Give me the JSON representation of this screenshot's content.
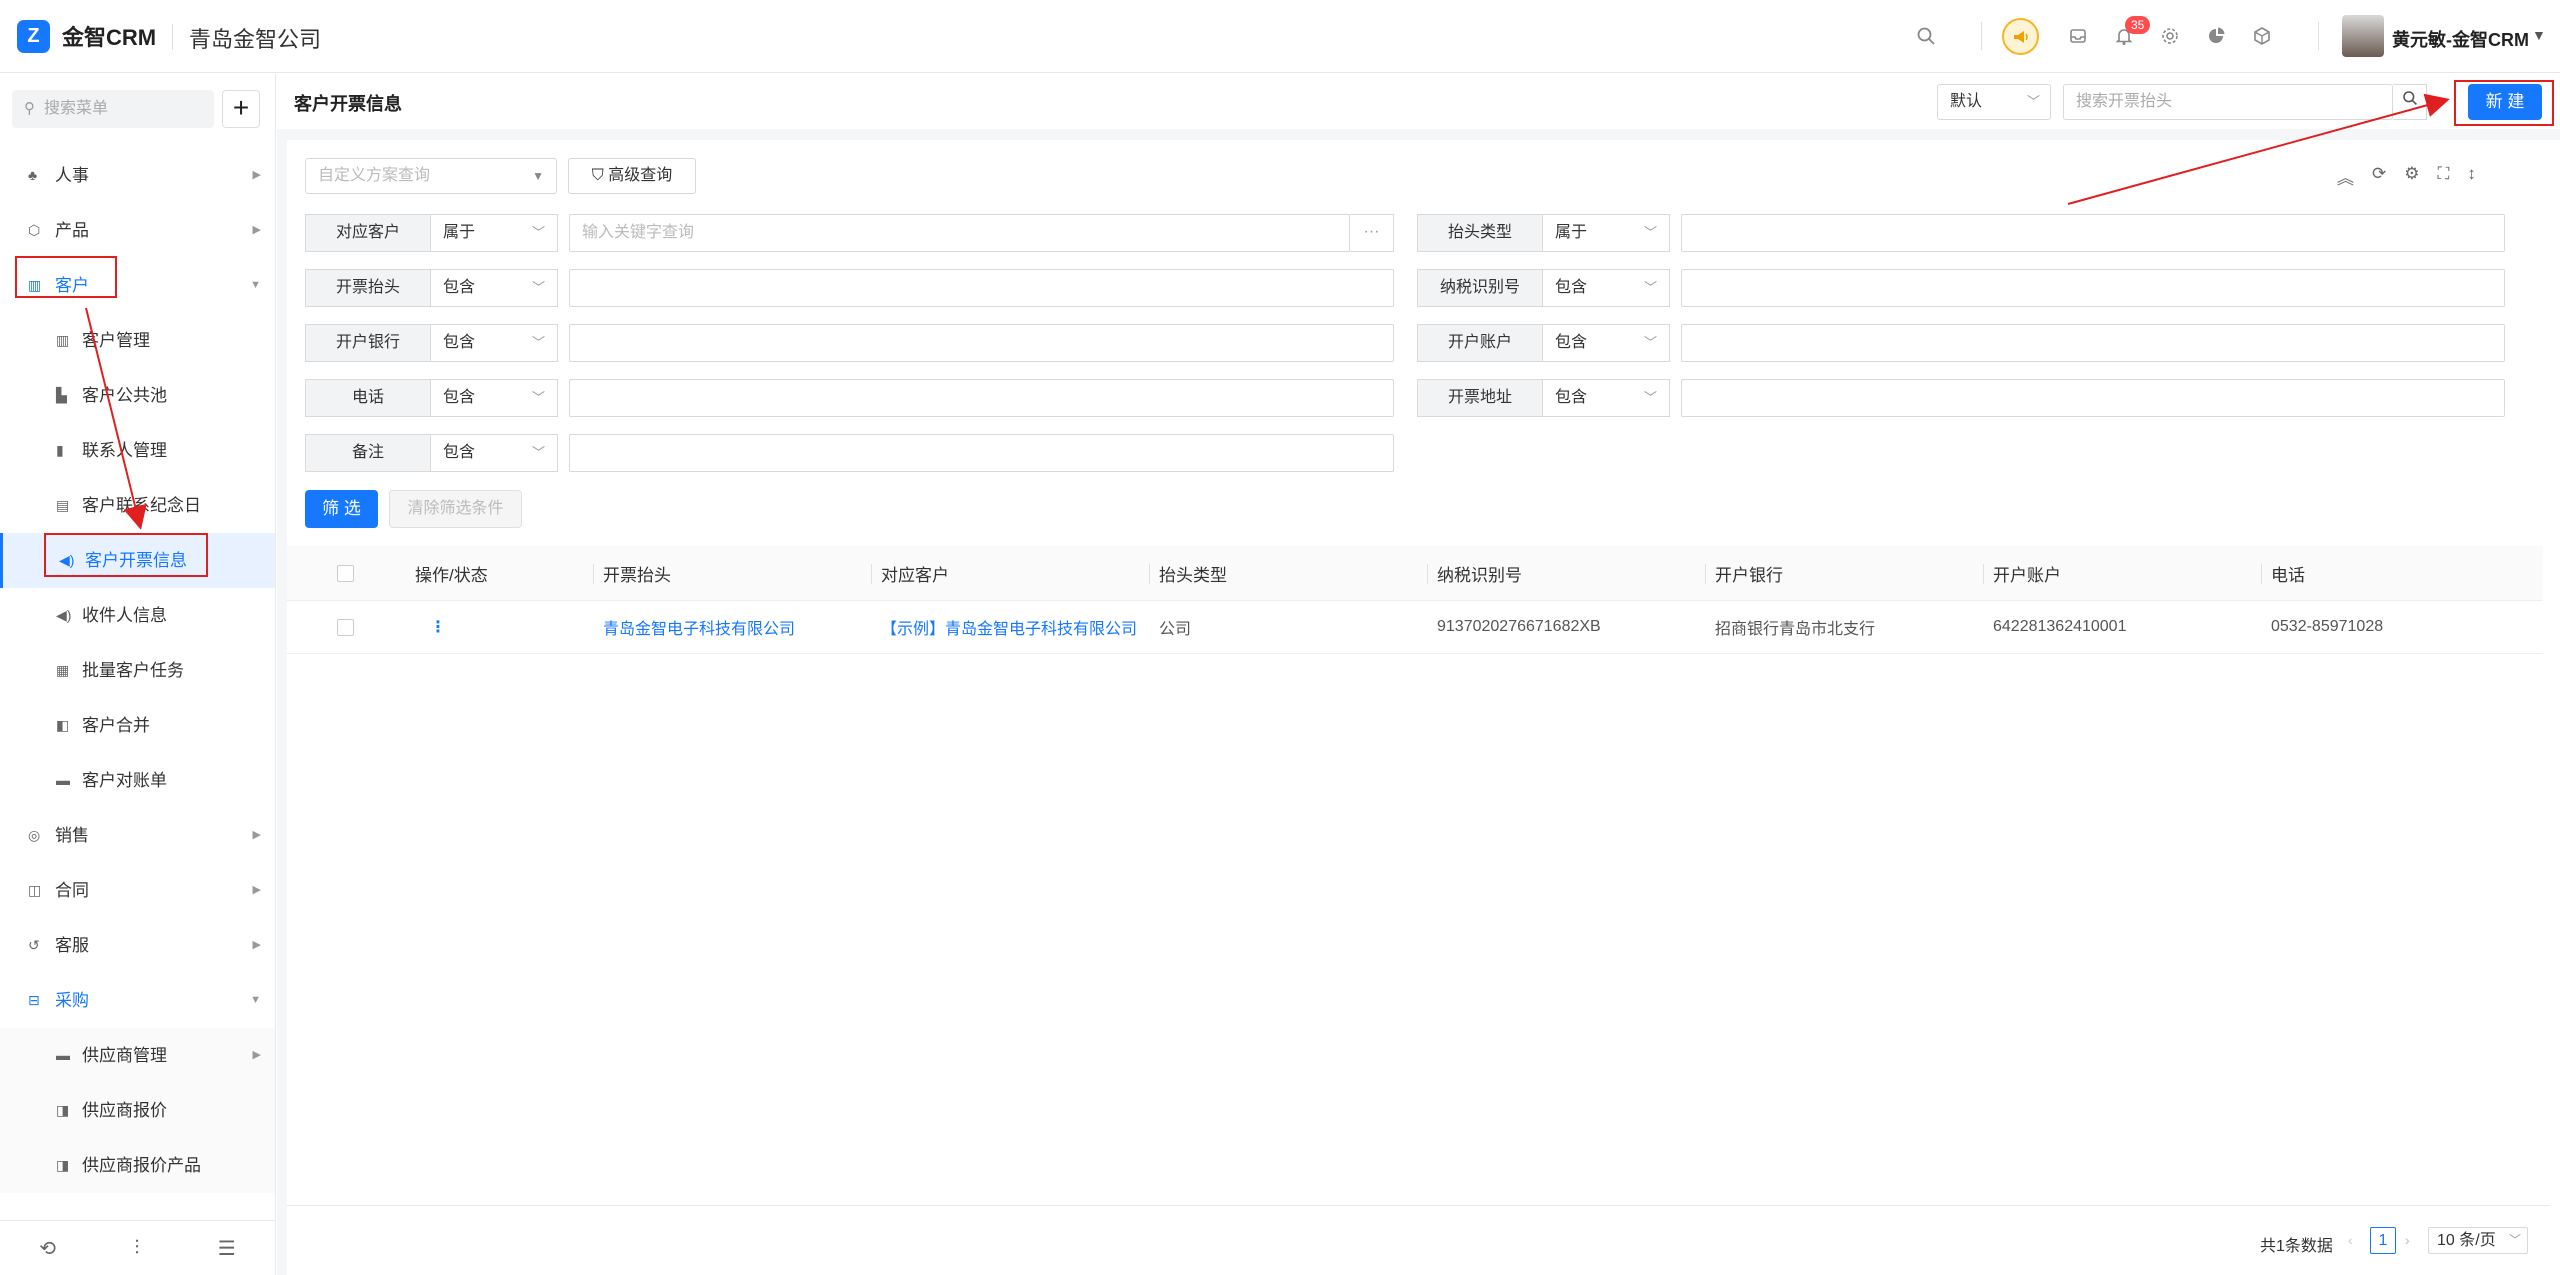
{
  "header": {
    "logo_glyph": "Z",
    "brand": "金智CRM",
    "company": "青岛金智公司",
    "notification_count": "35",
    "user_name": "黄元敏-金智CRM"
  },
  "sidebar": {
    "search_placeholder": "搜索菜单",
    "add_label": "+",
    "items": [
      {
        "label": "人事",
        "icon": "people-icon"
      },
      {
        "label": "产品",
        "icon": "cube-icon"
      },
      {
        "label": "客户",
        "icon": "building-icon"
      },
      {
        "label": "客户管理",
        "icon": "building-icon"
      },
      {
        "label": "客户公共池",
        "icon": "pool-icon"
      },
      {
        "label": "联系人管理",
        "icon": "contact-icon"
      },
      {
        "label": "客户联系纪念日",
        "icon": "calendar-icon"
      },
      {
        "label": "客户开票信息",
        "icon": "speaker-icon"
      },
      {
        "label": "收件人信息",
        "icon": "speaker-icon"
      },
      {
        "label": "批量客户任务",
        "icon": "task-icon"
      },
      {
        "label": "客户合并",
        "icon": "merge-icon"
      },
      {
        "label": "客户对账单",
        "icon": "statement-icon"
      },
      {
        "label": "销售",
        "icon": "sales-icon"
      },
      {
        "label": "合同",
        "icon": "contract-icon"
      },
      {
        "label": "客服",
        "icon": "service-icon"
      },
      {
        "label": "采购",
        "icon": "purchase-icon"
      },
      {
        "label": "供应商管理",
        "icon": "folder-icon"
      },
      {
        "label": "供应商报价",
        "icon": "quote-icon"
      },
      {
        "label": "供应商报价产品",
        "icon": "quote-icon"
      }
    ]
  },
  "topbar": {
    "title": "客户开票信息",
    "view_select": "默认",
    "search_placeholder": "搜索开票抬头",
    "new_label": "新 建"
  },
  "filters": {
    "custom_scheme_placeholder": "自定义方案查询",
    "advanced_label": "高级查询",
    "rows": [
      {
        "label": "对应客户",
        "op": "属于",
        "placeholder": "输入关键字查询"
      },
      {
        "label": "抬头类型",
        "op": "属于",
        "placeholder": ""
      },
      {
        "label": "开票抬头",
        "op": "包含",
        "placeholder": ""
      },
      {
        "label": "纳税识别号",
        "op": "包含",
        "placeholder": ""
      },
      {
        "label": "开户银行",
        "op": "包含",
        "placeholder": ""
      },
      {
        "label": "开户账户",
        "op": "包含",
        "placeholder": ""
      },
      {
        "label": "电话",
        "op": "包含",
        "placeholder": ""
      },
      {
        "label": "开票地址",
        "op": "包含",
        "placeholder": ""
      },
      {
        "label": "备注",
        "op": "包含",
        "placeholder": ""
      }
    ],
    "filter_label": "筛 选",
    "clear_label": "清除筛选条件"
  },
  "table": {
    "columns": [
      "操作/状态",
      "开票抬头",
      "对应客户",
      "抬头类型",
      "纳税识别号",
      "开户银行",
      "开户账户",
      "电话"
    ],
    "rows": [
      {
        "action": "⋮",
        "title": "青岛金智电子科技有限公司",
        "customer": "【示例】青岛金智电子科技有限公司",
        "type": "公司",
        "tax_id": "9137020276671682XB",
        "bank": "招商银行青岛市北支行",
        "account": "642281362410001",
        "phone": "0532-85971028"
      }
    ]
  },
  "pagination": {
    "total": "共1条数据",
    "current": "1",
    "page_size": "10 条/页"
  },
  "colors": {
    "accent": "#1677ff",
    "annotation": "#e02020"
  }
}
